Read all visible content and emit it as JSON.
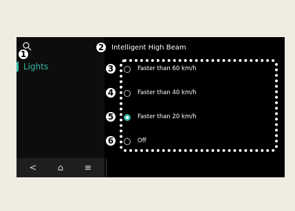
{
  "sidebar": {
    "search_icon": "search-icon",
    "selected_item": "Lights"
  },
  "screen": {
    "title": "Intelligent High Beam"
  },
  "options": [
    {
      "label": "Faster than 60 km/h",
      "selected": false
    },
    {
      "label": "Faster than 40 km/h",
      "selected": false
    },
    {
      "label": "Faster than 20 km/h",
      "selected": true
    },
    {
      "label": "Off",
      "selected": false
    }
  ],
  "bottom_nav": {
    "back_symbol": "<",
    "home_symbol": "⌂",
    "menu_symbol": "≡"
  },
  "callouts": [
    "1",
    "2",
    "3",
    "4",
    "5",
    "6"
  ],
  "colors": {
    "accent": "#36b7a7",
    "screen_bg": "#000000",
    "page_bg": "#efece2"
  }
}
